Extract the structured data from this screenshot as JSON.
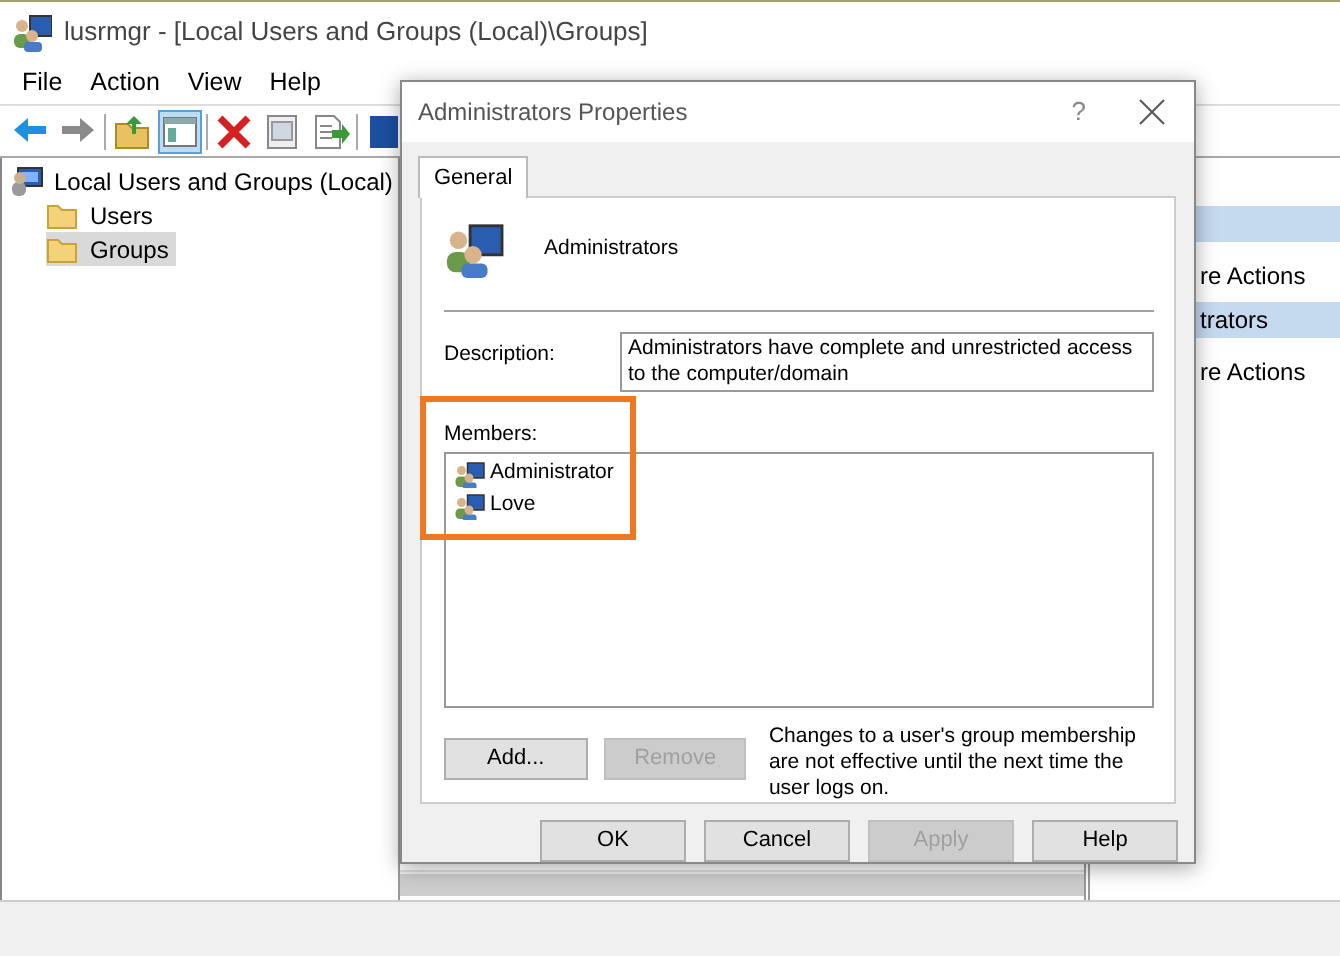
{
  "window": {
    "title": "lusrmgr - [Local Users and Groups (Local)\\Groups]"
  },
  "menu": [
    "File",
    "Action",
    "View",
    "Help"
  ],
  "toolbar": [
    {
      "kind": "back",
      "pressed": false
    },
    {
      "kind": "forward",
      "pressed": false
    },
    {
      "kind": "separator"
    },
    {
      "kind": "up",
      "pressed": false
    },
    {
      "kind": "tree",
      "pressed": true
    },
    {
      "kind": "separator"
    },
    {
      "kind": "delete",
      "pressed": false
    },
    {
      "kind": "properties",
      "pressed": false
    },
    {
      "kind": "export",
      "pressed": false
    },
    {
      "kind": "separator"
    },
    {
      "kind": "help",
      "pressed": false
    }
  ],
  "tree": [
    {
      "label": "Local Users and Groups (Local)",
      "kind": "computer",
      "selected": false,
      "children": [
        {
          "label": "Users",
          "kind": "folder",
          "selected": false
        },
        {
          "label": "Groups",
          "kind": "folder",
          "selected": true
        }
      ]
    }
  ],
  "actions": [
    {
      "kind": "header"
    },
    {
      "kind": "link",
      "label": "re Actions"
    },
    {
      "kind": "header",
      "label": "trators"
    },
    {
      "kind": "link",
      "label": "re Actions"
    }
  ],
  "dialog": {
    "title": "Administrators Properties",
    "help_glyph": "?",
    "tabs": [
      {
        "label": "General",
        "selected": true
      }
    ],
    "group_name": "Administrators",
    "description_label": "Description:",
    "description": "Administrators have complete and unrestricted access to the computer/domain",
    "members_label": "Members:",
    "highlight_members": true,
    "members": [
      {
        "label": "Administrator",
        "selected": false
      },
      {
        "label": "Love",
        "selected": false
      }
    ],
    "member_buttons": [
      {
        "label": "Add...",
        "disabled": false
      },
      {
        "label": "Remove",
        "disabled": true
      }
    ],
    "note": "Changes to a user's group membership are not effective until the next time the user logs on.",
    "buttons": [
      {
        "label": "OK",
        "disabled": false
      },
      {
        "label": "Cancel",
        "disabled": false
      },
      {
        "label": "Apply",
        "disabled": true
      },
      {
        "label": "Help",
        "disabled": false
      }
    ]
  }
}
